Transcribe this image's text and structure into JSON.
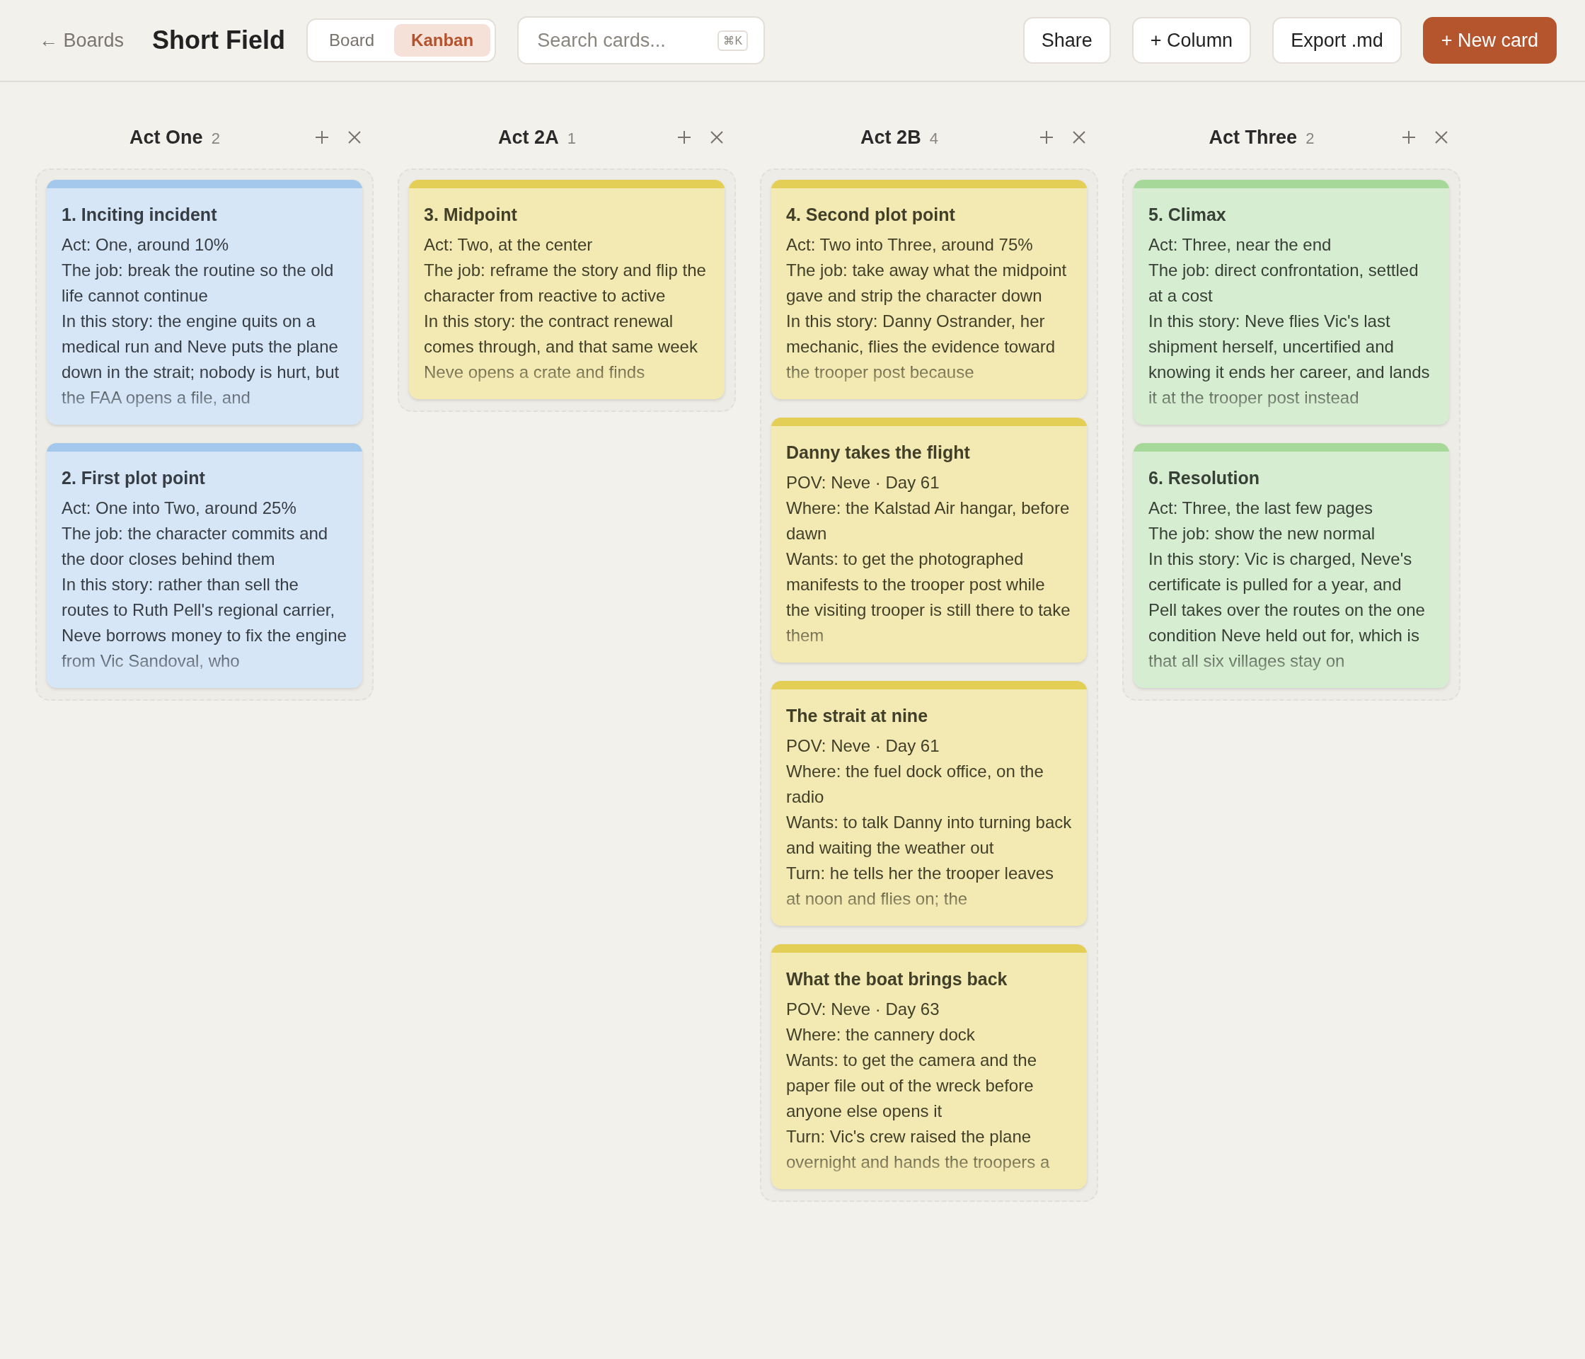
{
  "header": {
    "back_link": "← Boards",
    "title": "Short Field",
    "view_tabs": [
      {
        "label": "Board",
        "selected": false
      },
      {
        "label": "Kanban",
        "selected": true
      }
    ],
    "search": {
      "placeholder": "Search cards...",
      "shortcut": "⌘K"
    },
    "buttons": [
      {
        "label": "Share",
        "kind": "plain"
      },
      {
        "label": "+ Column",
        "kind": "plain"
      },
      {
        "label": "Export .md",
        "kind": "plain"
      },
      {
        "label": "+ New card",
        "kind": "primary"
      }
    ]
  },
  "columns": [
    {
      "title": "Act One",
      "count": "2",
      "cards": [
        {
          "title": "1. Inciting incident",
          "color": "#a3c8ec",
          "lines": [
            "Act: One, around 10%",
            "The job: break the routine so the old life cannot continue",
            "In this story: the engine quits on a medical run and Neve puts the plane down in the strait; nobody is hurt, but the FAA opens a file, and"
          ]
        },
        {
          "title": "2. First plot point",
          "color": "#a3c8ec",
          "lines": [
            "Act: One into Two, around 25%",
            "The job: the character commits and the door closes behind them",
            "In this story: rather than sell the routes to Ruth Pell's regional carrier, Neve borrows money to fix the engine from Vic Sandoval, who"
          ]
        }
      ]
    },
    {
      "title": "Act 2A",
      "count": "1",
      "cards": [
        {
          "title": "3. Midpoint",
          "color": "#e3cf55",
          "lines": [
            "Act: Two, at the center",
            "The job: reframe the story and flip the character from reactive to active",
            "In this story: the contract renewal comes through, and that same week Neve opens a crate and finds"
          ]
        }
      ]
    },
    {
      "title": "Act 2B",
      "count": "4",
      "cards": [
        {
          "title": "4. Second plot point",
          "color": "#e3cf55",
          "lines": [
            "Act: Two into Three, around 75%",
            "The job: take away what the midpoint gave and strip the character down",
            "In this story: Danny Ostrander, her mechanic, flies the evidence toward the trooper post because"
          ]
        },
        {
          "title": "Danny takes the flight",
          "color": "#e3cf55",
          "lines": [
            "POV: Neve · Day 61",
            "Where: the Kalstad Air hangar, before dawn",
            "Wants: to get the photographed manifests to the trooper post while the visiting trooper is still there to take them"
          ]
        },
        {
          "title": "The strait at nine",
          "color": "#e3cf55",
          "lines": [
            "POV: Neve · Day 61",
            "Where: the fuel dock office, on the radio",
            "Wants: to talk Danny into turning back and waiting the weather out",
            "Turn: he tells her the trooper leaves at noon and flies on; the"
          ]
        },
        {
          "title": "What the boat brings back",
          "color": "#e3cf55",
          "lines": [
            "POV: Neve · Day 63",
            "Where: the cannery dock",
            "Wants: to get the camera and the paper file out of the wreck before anyone else opens it",
            "Turn: Vic's crew raised the plane overnight and hands the troopers a"
          ]
        }
      ]
    },
    {
      "title": "Act Three",
      "count": "2",
      "cards": [
        {
          "title": "5. Climax",
          "color": "#a6d89a",
          "lines": [
            "Act: Three, near the end",
            "The job: direct confrontation, settled at a cost",
            "In this story: Neve flies Vic's last shipment herself, uncertified and knowing it ends her career, and lands it at the trooper post instead"
          ]
        },
        {
          "title": "6. Resolution",
          "color": "#a6d89a",
          "lines": [
            "Act: Three, the last few pages",
            "The job: show the new normal",
            "In this story: Vic is charged, Neve's certificate is pulled for a year, and Pell takes over the routes on the one condition Neve held out for, which is that all six villages stay on"
          ]
        }
      ]
    }
  ]
}
